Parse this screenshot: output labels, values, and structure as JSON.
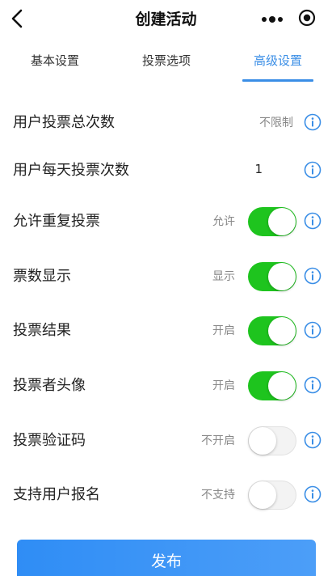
{
  "nav": {
    "title": "创建活动"
  },
  "tabs": [
    {
      "label": "基本设置"
    },
    {
      "label": "投票选项"
    },
    {
      "label": "高级设置"
    }
  ],
  "settings": [
    {
      "label": "用户投票总次数",
      "value": "不限制"
    },
    {
      "label": "用户每天投票次数",
      "value": "1"
    },
    {
      "label": "允许重复投票",
      "value": "允许",
      "enabled": true
    },
    {
      "label": "票数显示",
      "value": "显示",
      "enabled": true
    },
    {
      "label": "投票结果",
      "value": "开启",
      "enabled": true
    },
    {
      "label": "投票者头像",
      "value": "开启",
      "enabled": true
    },
    {
      "label": "投票验证码",
      "value": "不开启",
      "enabled": false
    },
    {
      "label": "支持用户报名",
      "value": "不支持",
      "enabled": false
    }
  ],
  "submit_label": "发布",
  "colors": {
    "accent": "#3a8ee6",
    "toggle_on": "#1ec41e",
    "button": "#2f8df5"
  },
  "icons": [
    "back-arrow-icon",
    "more-dots-icon",
    "record-icon",
    "info-icon"
  ]
}
